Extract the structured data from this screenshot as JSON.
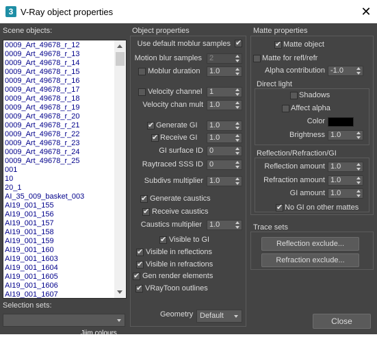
{
  "window": {
    "title": "V-Ray object properties",
    "app_icon_glyph": "3",
    "close_glyph": "✕"
  },
  "scene": {
    "label": "Scene objects:",
    "items": [
      "0009_Art_49678_r_12",
      "0009_Art_49678_r_13",
      "0009_Art_49678_r_14",
      "0009_Art_49678_r_15",
      "0009_Art_49678_r_16",
      "0009_Art_49678_r_17",
      "0009_Art_49678_r_18",
      "0009_Art_49678_r_19",
      "0009_Art_49678_r_20",
      "0009_Art_49678_r_21",
      "0009_Art_49678_r_22",
      "0009_Art_49678_r_23",
      "0009_Art_49678_r_24",
      "0009_Art_49678_r_25",
      "001",
      "10",
      "20_1",
      "AI_35_009_basket_003",
      "AI19_001_155",
      "AI19_001_156",
      "AI19_001_157",
      "AI19_001_158",
      "AI19_001_159",
      "AI19_001_160",
      "AI19_001_1603",
      "AI19_001_1604",
      "AI19_001_1605",
      "AI19_001_1606",
      "AI19_001_1607"
    ],
    "selection_sets_label": "Selection sets:",
    "selection_sets_value": ""
  },
  "object_properties": {
    "title": "Object properties",
    "use_default_moblur": {
      "label": "Use default moblur samples",
      "checked": true
    },
    "motion_blur_samples": {
      "label": "Motion blur samples",
      "value": "2"
    },
    "moblur_duration": {
      "label": "Moblur duration",
      "value": "1.0",
      "checked": false
    },
    "velocity_channel": {
      "label": "Velocity channel",
      "value": "1",
      "checked": false
    },
    "velocity_chan_mult": {
      "label": "Velocity chan mult",
      "value": "1.0"
    },
    "generate_gi": {
      "label": "Generate GI",
      "value": "1.0",
      "checked": true
    },
    "receive_gi": {
      "label": "Receive GI",
      "value": "1.0",
      "checked": true
    },
    "gi_surface_id": {
      "label": "GI surface ID",
      "value": "0"
    },
    "raytraced_sss_id": {
      "label": "Raytraced SSS ID",
      "value": "0"
    },
    "subdivs_multiplier": {
      "label": "Subdivs multiplier",
      "value": "1.0"
    },
    "generate_caustics": {
      "label": "Generate caustics",
      "checked": true
    },
    "receive_caustics": {
      "label": "Receive caustics",
      "checked": true
    },
    "caustics_multiplier": {
      "label": "Caustics multiplier",
      "value": "1.0"
    },
    "visible_to_gi": {
      "label": "Visible to GI",
      "checked": true
    },
    "visible_in_reflections": {
      "label": "Visible in reflections",
      "checked": true
    },
    "visible_in_refractions": {
      "label": "Visible in refractions",
      "checked": true
    },
    "gen_render_elements": {
      "label": "Gen render elements",
      "checked": true
    },
    "vraytoon_outlines": {
      "label": "VRayToon outlines",
      "checked": true
    },
    "geometry": {
      "label": "Geometry",
      "value": "Default"
    }
  },
  "matte_properties": {
    "title": "Matte properties",
    "matte_object": {
      "label": "Matte object",
      "checked": true
    },
    "matte_refl_refr": {
      "label": "Matte for refl/refr",
      "checked": false
    },
    "alpha_contribution": {
      "label": "Alpha contribution",
      "value": "-1.0"
    },
    "direct_light": {
      "title": "Direct light",
      "shadows": {
        "label": "Shadows",
        "checked": false
      },
      "affect_alpha": {
        "label": "Affect alpha",
        "checked": false
      },
      "color": {
        "label": "Color",
        "swatch": "#000000"
      },
      "brightness": {
        "label": "Brightness",
        "value": "1.0"
      }
    },
    "rrgi": {
      "title": "Reflection/Refraction/GI",
      "reflection_amount": {
        "label": "Reflection amount",
        "value": "1.0"
      },
      "refraction_amount": {
        "label": "Refraction amount",
        "value": "1.0"
      },
      "gi_amount": {
        "label": "GI amount",
        "value": "1.0"
      },
      "no_gi_other_mattes": {
        "label": "No GI on other mattes",
        "checked": true
      }
    }
  },
  "trace_sets": {
    "title": "Trace sets",
    "reflection_exclude": "Reflection exclude...",
    "refraction_exclude": "Refraction exclude..."
  },
  "close_button": "Close",
  "behind_text": "Jiim colours"
}
